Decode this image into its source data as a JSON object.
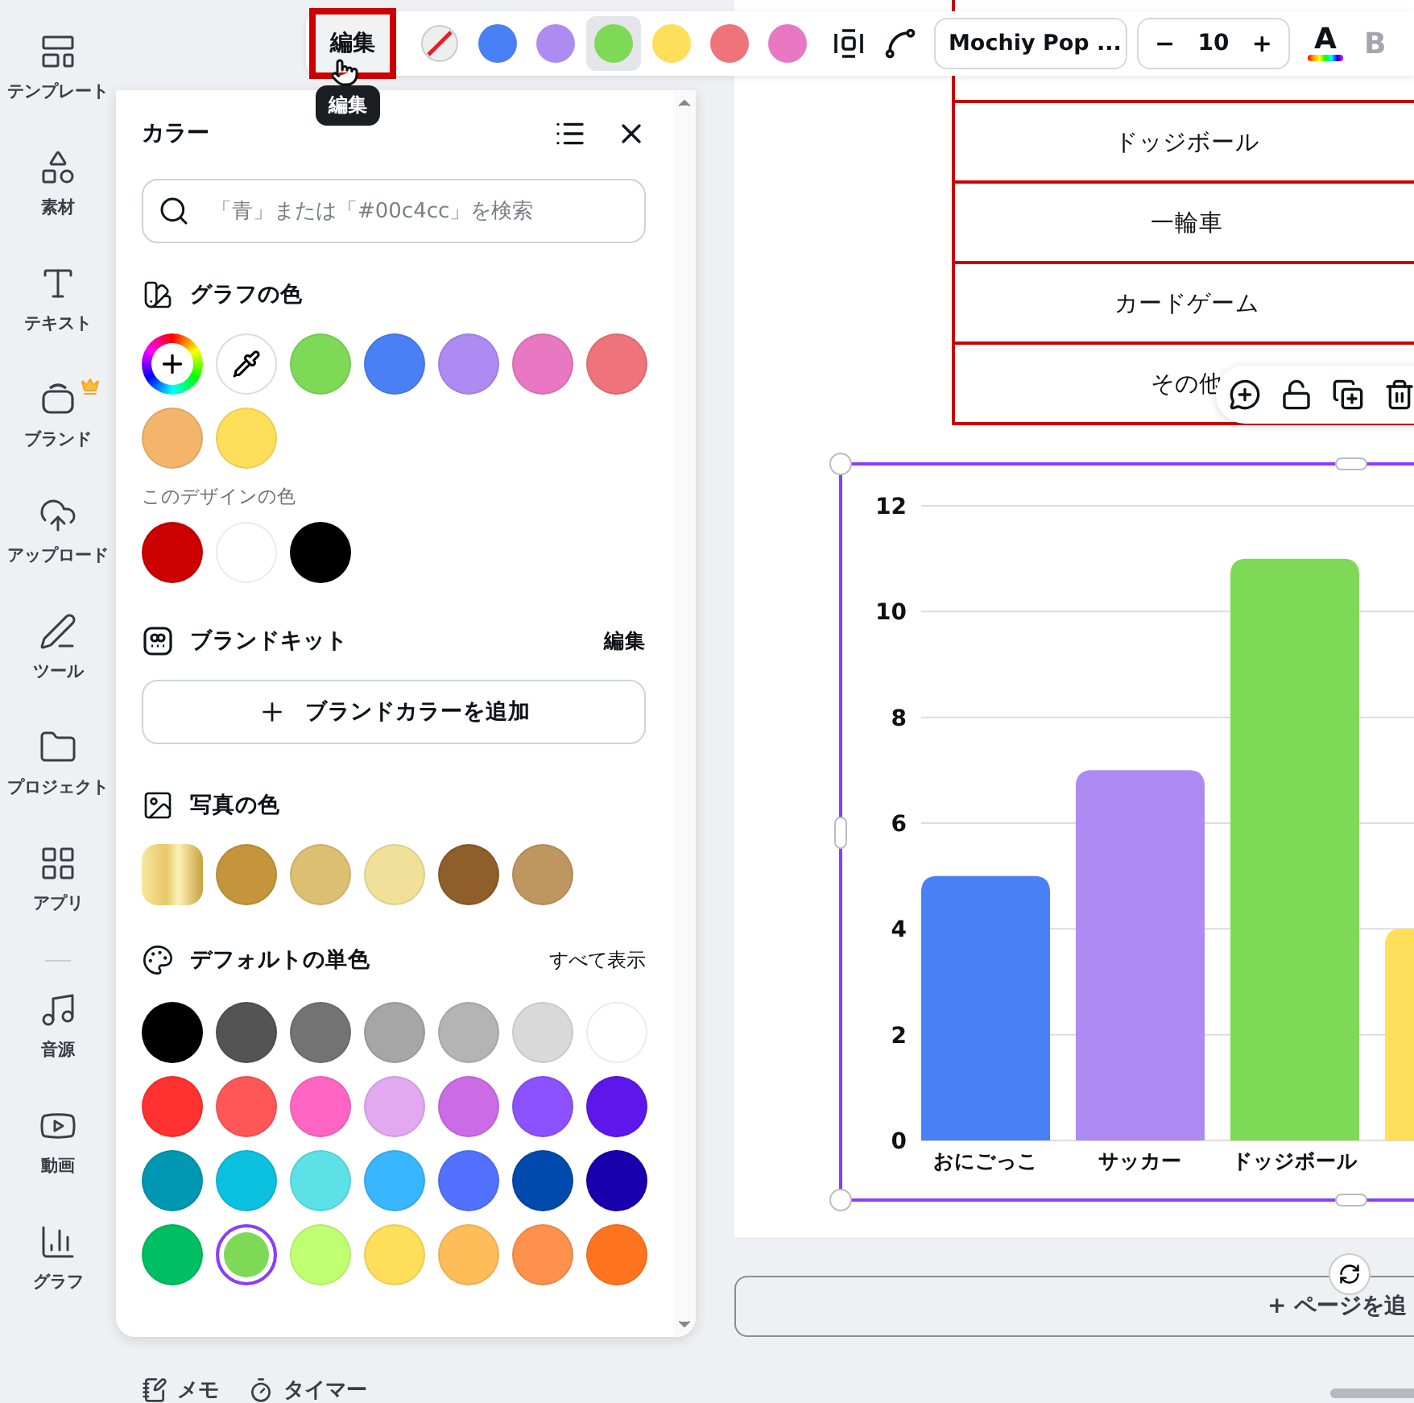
{
  "sidebar": {
    "items": [
      {
        "label": "テンプレート",
        "premium": false
      },
      {
        "label": "素材",
        "premium": false
      },
      {
        "label": "テキスト",
        "premium": false
      },
      {
        "label": "ブランド",
        "premium": true
      },
      {
        "label": "アップロード",
        "premium": false
      },
      {
        "label": "ツール",
        "premium": false
      },
      {
        "label": "プロジェクト",
        "premium": false
      },
      {
        "label": "アプリ",
        "premium": false
      },
      {
        "label": "音源",
        "premium": false
      },
      {
        "label": "動画",
        "premium": false
      },
      {
        "label": "グラフ",
        "premium": false
      }
    ]
  },
  "toolbar": {
    "edit_button": "編集",
    "tooltip": "編集",
    "swatches": [
      {
        "color": "#4a80f5",
        "selected": false
      },
      {
        "color": "#ae8bf2",
        "selected": false
      },
      {
        "color": "#7ed957",
        "selected": true
      },
      {
        "color": "#ffde59",
        "selected": false
      },
      {
        "color": "#ef737a",
        "selected": false
      },
      {
        "color": "#e878c1",
        "selected": false
      }
    ],
    "font": "Mochiy Pop ...",
    "decrease": "−",
    "font_size": "10",
    "increase": "+",
    "text_color_label": "A",
    "bold_label": "B",
    "bold_disabled": true
  },
  "panel": {
    "title": "カラー",
    "search": {
      "placeholder": "「青」または「#00c4cc」を検索"
    },
    "chart_colors": {
      "title": "グラフの色",
      "colors": [
        {
          "color": "#7ed957"
        },
        {
          "color": "#4a80f5"
        },
        {
          "color": "#ae8bf2"
        },
        {
          "color": "#e878c1"
        },
        {
          "color": "#ef737a"
        },
        {
          "color": "#f2b56b"
        },
        {
          "color": "#ffde59"
        }
      ]
    },
    "design_colors": {
      "title": "このデザインの色",
      "colors": [
        {
          "color": "#cc0000"
        },
        {
          "color": "#ffffff"
        },
        {
          "color": "#000000"
        }
      ]
    },
    "brand_kit": {
      "title": "ブランドキット",
      "edit": "編集",
      "add_button": "ブランドカラーを追加"
    },
    "photo_colors": {
      "title": "写真の色",
      "colors": [
        {
          "kind": "gradient"
        },
        {
          "kind": "solid",
          "color": "#c4953b"
        },
        {
          "kind": "solid",
          "color": "#ddbf72"
        },
        {
          "kind": "solid",
          "color": "#f0e09a"
        },
        {
          "kind": "solid",
          "color": "#8f5e2a"
        },
        {
          "kind": "solid",
          "color": "#be9760"
        }
      ]
    },
    "default_colors": {
      "title": "デフォルトの単色",
      "show_all": "すべて表示",
      "colors": [
        {
          "color": "#000000",
          "selected": false
        },
        {
          "color": "#545454",
          "selected": false
        },
        {
          "color": "#737373",
          "selected": false
        },
        {
          "color": "#a6a6a6",
          "selected": false
        },
        {
          "color": "#b4b4b4",
          "selected": false
        },
        {
          "color": "#d9d9d9",
          "selected": false
        },
        {
          "color": "#ffffff",
          "selected": false
        },
        {
          "color": "#ff3131",
          "selected": false
        },
        {
          "color": "#ff5757",
          "selected": false
        },
        {
          "color": "#ff66c4",
          "selected": false
        },
        {
          "color": "#e2a9f1",
          "selected": false
        },
        {
          "color": "#cb6ce6",
          "selected": false
        },
        {
          "color": "#8c52ff",
          "selected": false
        },
        {
          "color": "#5e17eb",
          "selected": false
        },
        {
          "color": "#0097b2",
          "selected": false
        },
        {
          "color": "#0cc0df",
          "selected": false
        },
        {
          "color": "#5ce1e6",
          "selected": false
        },
        {
          "color": "#38b6ff",
          "selected": false
        },
        {
          "color": "#5271ff",
          "selected": false
        },
        {
          "color": "#004aad",
          "selected": false
        },
        {
          "color": "#1800ad",
          "selected": false
        },
        {
          "color": "#00bf63",
          "selected": false
        },
        {
          "color": "#7ed957",
          "selected": true
        },
        {
          "color": "#c1ff72",
          "selected": false
        },
        {
          "color": "#ffde59",
          "selected": false
        },
        {
          "color": "#ffbd59",
          "selected": false
        },
        {
          "color": "#ff914d",
          "selected": false
        },
        {
          "color": "#ff751f",
          "selected": false
        }
      ]
    }
  },
  "canvas": {
    "table": {
      "rows": [
        "ドッジボール",
        "一輪車",
        "カードゲーム",
        "その他"
      ]
    },
    "chart": {
      "chart_data": {
        "type": "bar",
        "categories": [
          "おにごっこ",
          "サッカー",
          "ドッジボール",
          null
        ],
        "series": [
          {
            "color": "#4a80f5",
            "values": [
              5,
              null,
              null,
              null
            ]
          },
          {
            "color": "#ae8bf2",
            "values": [
              null,
              7,
              null,
              null
            ]
          },
          {
            "color": "#7ed957",
            "values": [
              null,
              null,
              11,
              null
            ]
          },
          {
            "color": "#ffde59",
            "values": [
              null,
              null,
              null,
              4
            ]
          }
        ],
        "stacked": true,
        "grid": true,
        "ylim": [
          0,
          12
        ],
        "yticks": [
          0,
          2,
          4,
          6,
          8,
          10,
          12
        ]
      }
    },
    "add_page": "+ ページを追"
  },
  "footer": {
    "memo": "メモ",
    "timer": "タイマー"
  }
}
